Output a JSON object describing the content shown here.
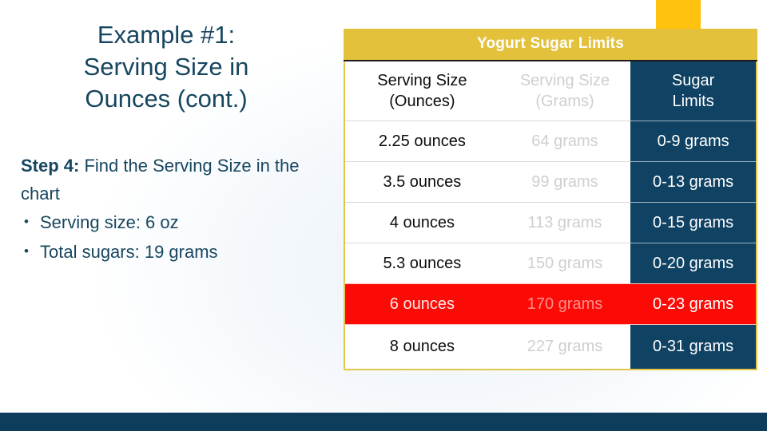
{
  "slide": {
    "title_lines": [
      "Example #1:",
      "Serving Size in",
      "Ounces (cont.)"
    ],
    "step_label": "Step 4:",
    "step_text": " Find the Serving Size in the chart",
    "bullets": [
      "Serving size: 6 oz",
      "Total sugars: 19 grams"
    ]
  },
  "colors": {
    "title_navy": "#17465F",
    "band_yellow": "#E3C13B",
    "tab_yellow": "#FFC20E",
    "navy_column": "#0F4263",
    "highlight_red": "#FC0B06",
    "bottom_band": "#0E3D5C"
  },
  "table": {
    "title": "Yogurt Sugar Limits",
    "columns": [
      {
        "line1": "Serving Size",
        "line2": "(Ounces)"
      },
      {
        "line1": "Serving Size",
        "line2": "(Grams)"
      },
      {
        "line1": "Sugar",
        "line2": "Limits"
      }
    ],
    "rows": [
      {
        "ounces": "2.25 ounces",
        "grams": "64 grams",
        "limits": "0-9 grams",
        "highlight": false
      },
      {
        "ounces": "3.5 ounces",
        "grams": "99 grams",
        "limits": "0-13 grams",
        "highlight": false
      },
      {
        "ounces": "4 ounces",
        "grams": "113 grams",
        "limits": "0-15 grams",
        "highlight": false
      },
      {
        "ounces": "5.3 ounces",
        "grams": "150 grams",
        "limits": "0-20 grams",
        "highlight": false
      },
      {
        "ounces": "6 ounces",
        "grams": "170 grams",
        "limits": "0-23 grams",
        "highlight": true
      },
      {
        "ounces": "8 ounces",
        "grams": "227 grams",
        "limits": "0-31 grams",
        "highlight": false
      }
    ]
  }
}
